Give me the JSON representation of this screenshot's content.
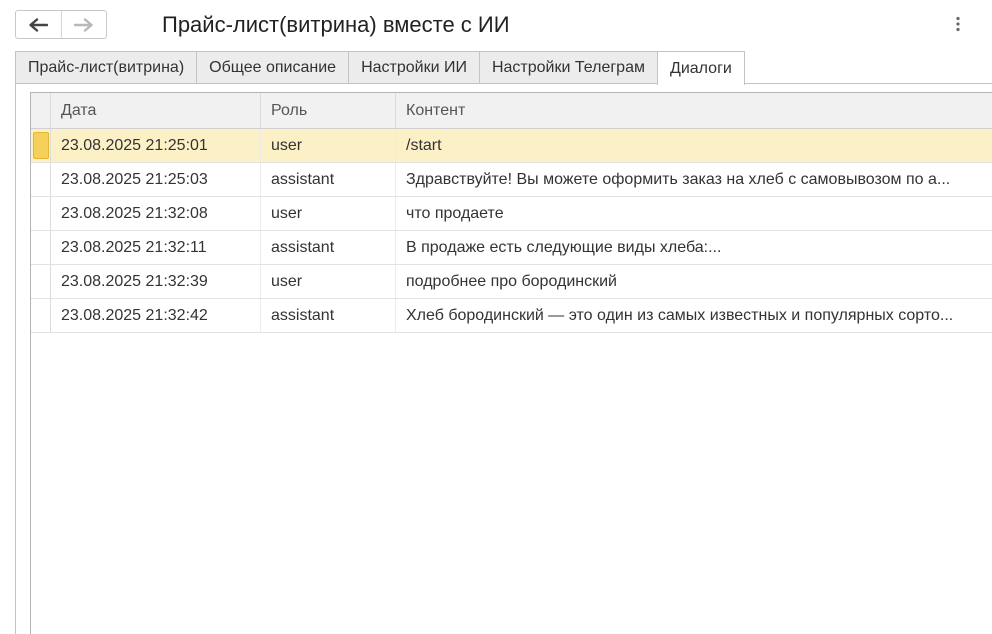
{
  "header": {
    "title": "Прайс-лист(витрина) вместе с ИИ",
    "back_icon": "arrow-left-icon",
    "forward_icon": "arrow-right-icon",
    "more_icon": "more-vertical-icon"
  },
  "tabs": [
    {
      "label": "Прайс-лист(витрина)",
      "active": false
    },
    {
      "label": "Общее описание",
      "active": false
    },
    {
      "label": "Настройки ИИ",
      "active": false
    },
    {
      "label": "Настройки Телеграм",
      "active": false
    },
    {
      "label": "Диалоги",
      "active": true
    }
  ],
  "table": {
    "columns": {
      "date": "Дата",
      "role": "Роль",
      "content": "Контент"
    },
    "rows": [
      {
        "date": "23.08.2025 21:25:01",
        "role": "user",
        "content": "/start"
      },
      {
        "date": "23.08.2025 21:25:03",
        "role": "assistant",
        "content": "Здравствуйте! Вы можете оформить заказ на хлеб с самовывозом по а..."
      },
      {
        "date": "23.08.2025 21:32:08",
        "role": "user",
        "content": "что продаете"
      },
      {
        "date": "23.08.2025 21:32:11",
        "role": "assistant",
        "content": "В продаже есть следующие виды хлеба:..."
      },
      {
        "date": "23.08.2025 21:32:39",
        "role": "user",
        "content": "подробнее про бородинский"
      },
      {
        "date": "23.08.2025 21:32:42",
        "role": "assistant",
        "content": "Хлеб бородинский — это один из самых известных и популярных сорто..."
      }
    ],
    "selected_row": 0
  },
  "colors": {
    "selected_row": "#fbf0c6",
    "row_marker": "#f5d15c",
    "header_bg": "#f1f1f1",
    "tab_inactive": "#ececec"
  }
}
